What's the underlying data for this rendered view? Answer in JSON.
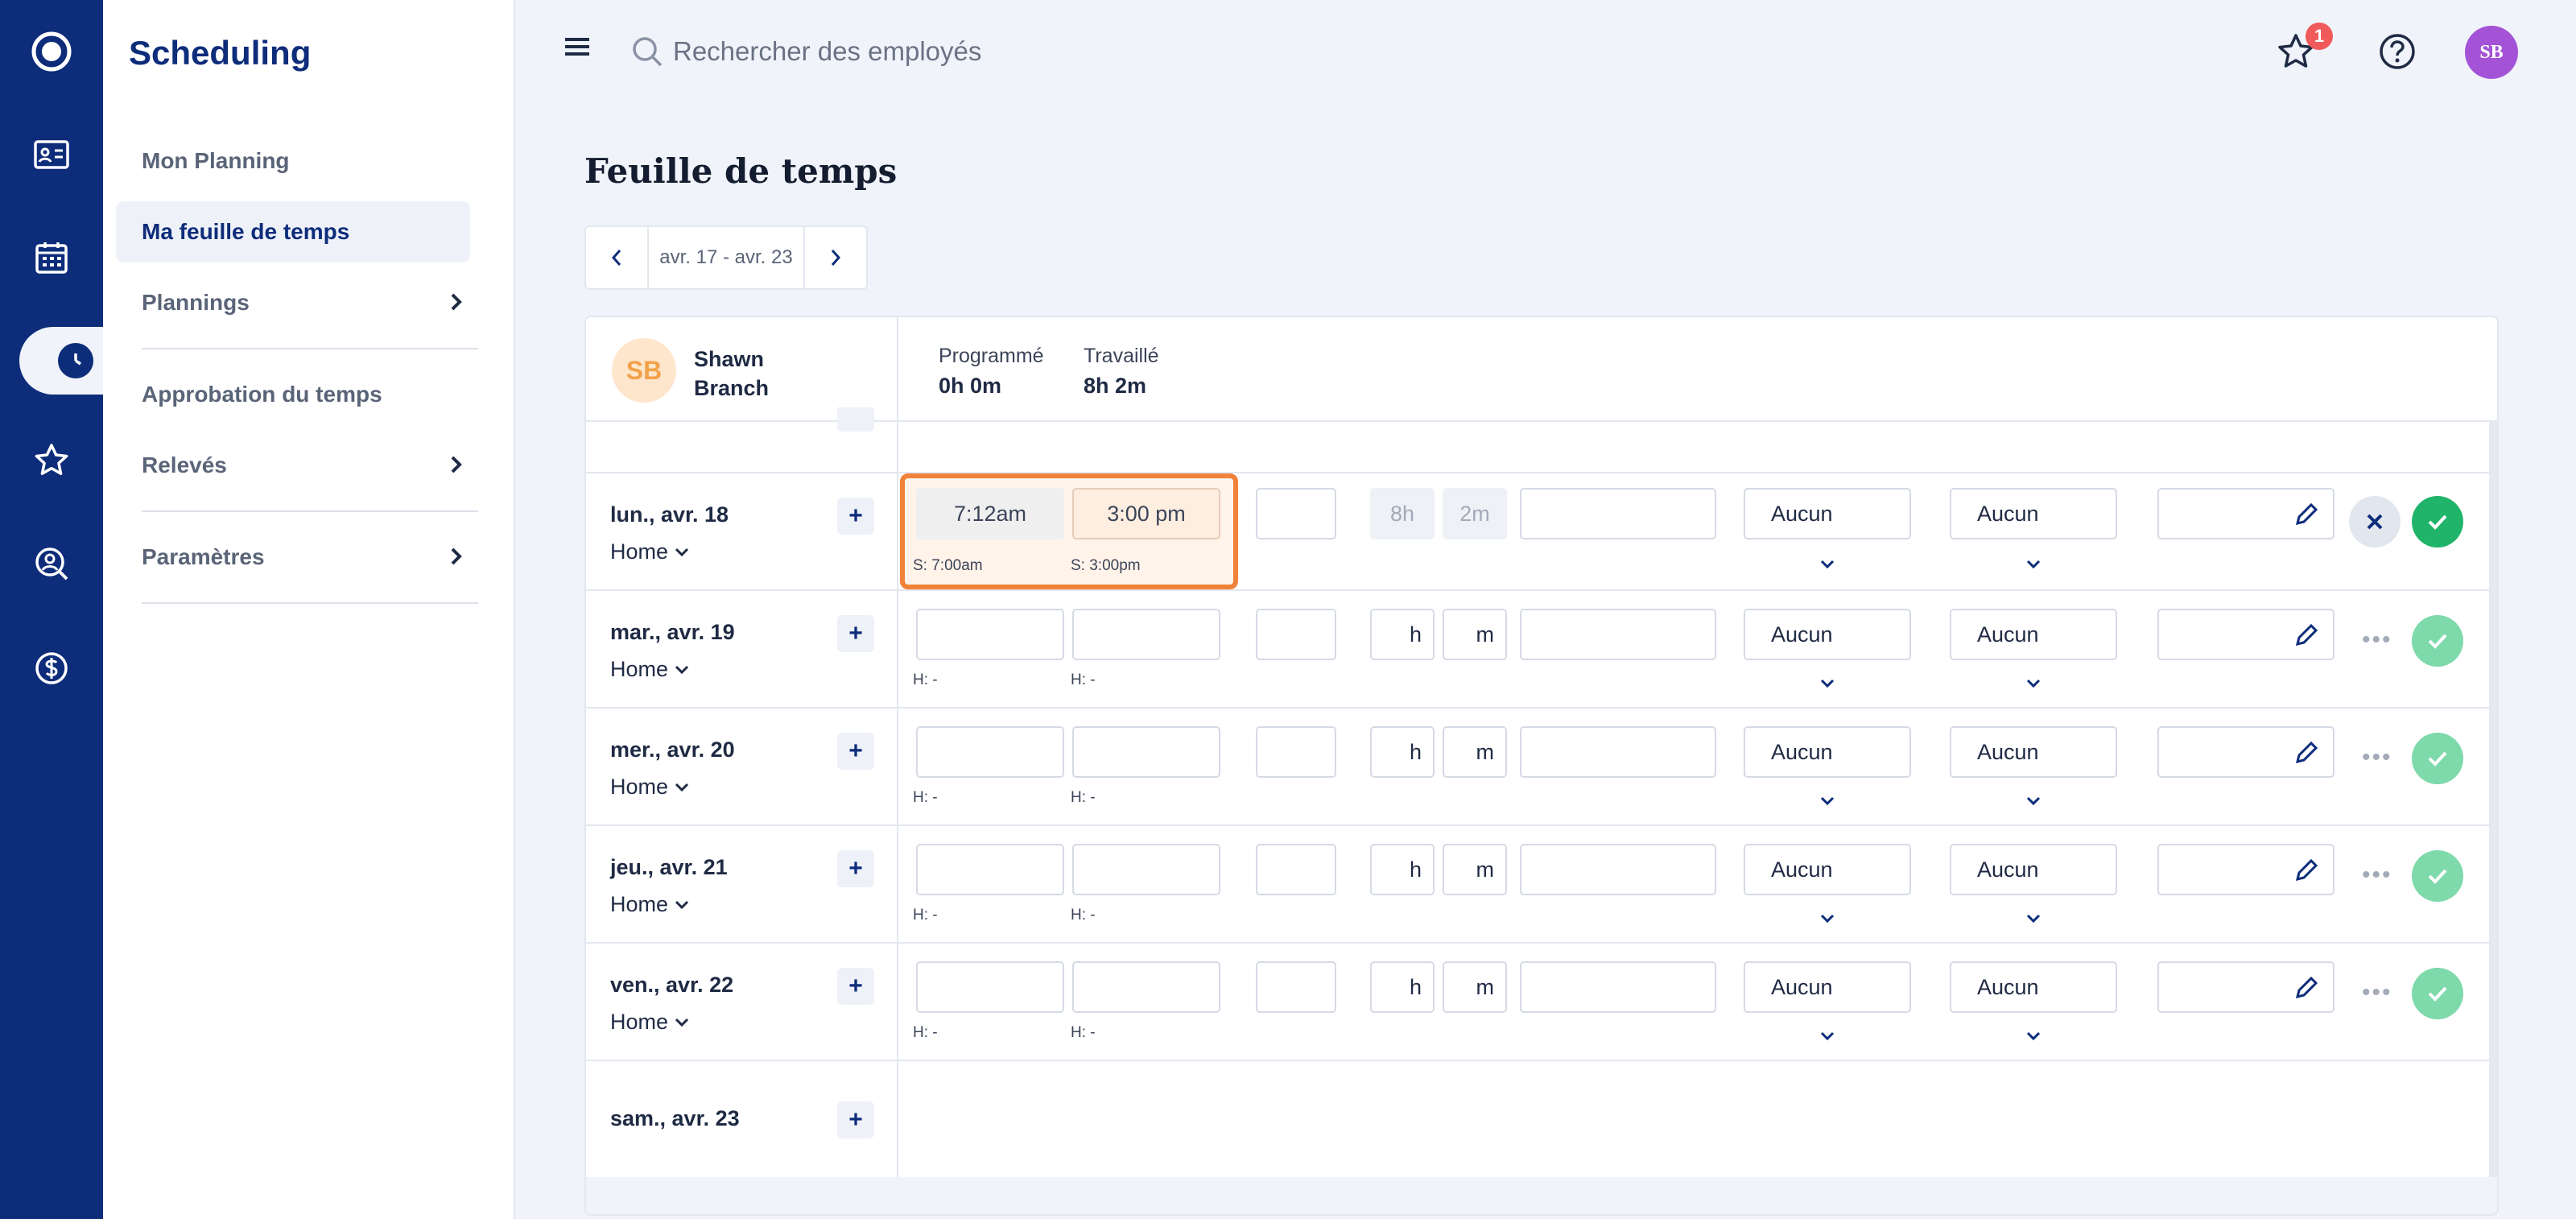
{
  "app": {
    "section_title": "Scheduling"
  },
  "rail": {
    "icons": [
      "logo-icon",
      "id-card-icon",
      "calendar-icon",
      "clock-icon",
      "star-icon",
      "people-search-icon",
      "dollar-icon"
    ],
    "active": "clock-icon"
  },
  "subnav": {
    "items": [
      {
        "label": "Mon Planning"
      },
      {
        "label": "Ma feuille de temps",
        "active": true
      },
      {
        "label": "Plannings",
        "has_children": true
      },
      {
        "label": "Approbation du temps"
      },
      {
        "label": "Relevés",
        "has_children": true
      },
      {
        "label": "Paramètres",
        "has_children": true
      }
    ]
  },
  "topbar": {
    "search_placeholder": "Rechercher des employés",
    "notification_count": "1",
    "user_initials": "SB"
  },
  "page": {
    "title": "Feuille de temps"
  },
  "week": {
    "range": "avr. 17 - avr. 23"
  },
  "employee": {
    "initials": "SB",
    "name": "Shawn Branch",
    "scheduled_label": "Programmé",
    "scheduled_value": "0h 0m",
    "worked_label": "Travaillé",
    "worked_value": "8h 2m"
  },
  "rows": [
    {
      "day": "lun., avr. 18",
      "location": "Home",
      "start": "7:12am",
      "end": "3:00 pm",
      "start_sub": "S: 7:00am",
      "end_sub": "S: 3:00pm",
      "break": "",
      "hours": "8h",
      "minutes": "2m",
      "note": "",
      "select1": "Aucun",
      "select2": "Aucun",
      "comment": "",
      "state": "editing"
    },
    {
      "day": "mar., avr. 19",
      "location": "Home",
      "start": "",
      "end": "",
      "start_sub": "H: -",
      "end_sub": "H: -",
      "break": "",
      "hours": "h",
      "minutes": "m",
      "note": "",
      "select1": "Aucun",
      "select2": "Aucun",
      "comment": "",
      "state": "idle"
    },
    {
      "day": "mer., avr. 20",
      "location": "Home",
      "start": "",
      "end": "",
      "start_sub": "H: -",
      "end_sub": "H: -",
      "break": "",
      "hours": "h",
      "minutes": "m",
      "note": "",
      "select1": "Aucun",
      "select2": "Aucun",
      "comment": "",
      "state": "idle"
    },
    {
      "day": "jeu., avr. 21",
      "location": "Home",
      "start": "",
      "end": "",
      "start_sub": "H: -",
      "end_sub": "H: -",
      "break": "",
      "hours": "h",
      "minutes": "m",
      "note": "",
      "select1": "Aucun",
      "select2": "Aucun",
      "comment": "",
      "state": "idle"
    },
    {
      "day": "ven., avr. 22",
      "location": "Home",
      "start": "",
      "end": "",
      "start_sub": "H: -",
      "end_sub": "H: -",
      "break": "",
      "hours": "h",
      "minutes": "m",
      "note": "",
      "select1": "Aucun",
      "select2": "Aucun",
      "comment": "",
      "state": "idle"
    },
    {
      "day": "sam., avr. 23",
      "empty": true
    }
  ],
  "more_label": "•••",
  "colors": {
    "rail": "#0d2c7a",
    "accent": "#f0823a",
    "approve": "#1fb46a",
    "avatar": "#a453d6"
  }
}
